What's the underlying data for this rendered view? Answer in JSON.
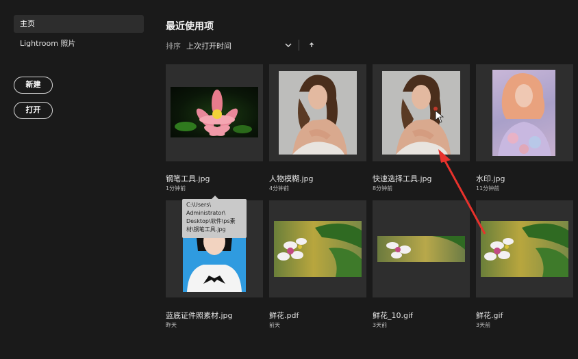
{
  "sidebar": {
    "items": [
      {
        "label": "主页",
        "active": true
      },
      {
        "label": "Lightroom 照片",
        "active": false
      }
    ],
    "new_label": "新建",
    "open_label": "打开"
  },
  "main": {
    "title": "最近使用项",
    "sort_label": "排序",
    "sort_value": "上次打开时间"
  },
  "files": [
    {
      "name": "钢笔工具.jpg",
      "time": "1分钟前",
      "icon": "lotus-thumbnail"
    },
    {
      "name": "人物模糊.jpg",
      "time": "4分钟前",
      "icon": "portrait-thumbnail"
    },
    {
      "name": "快速选择工具.jpg",
      "time": "8分钟前",
      "icon": "portrait-thumbnail"
    },
    {
      "name": "水印.jpg",
      "time": "11分钟前",
      "icon": "watercolor-portrait-thumbnail"
    },
    {
      "name": "蓝底证件照素材.jpg",
      "time": "昨天",
      "icon": "id-photo-thumbnail"
    },
    {
      "name": "鲜花.pdf",
      "time": "前天",
      "icon": "flower-thumbnail"
    },
    {
      "name": "鲜花_10.gif",
      "time": "3天前",
      "icon": "flower-thumbnail"
    },
    {
      "name": "鲜花.gif",
      "time": "3天前",
      "icon": "flower-thumbnail"
    }
  ],
  "tooltip": {
    "lines": [
      "C:\\Users\\",
      "Administrator\\",
      "Desktop\\软件\\ps素",
      "材\\钢笔工具.jpg"
    ]
  },
  "colors": {
    "background": "#1a1a1a",
    "tile": "#2e2e2e",
    "annotation_arrow": "#e8322c"
  }
}
